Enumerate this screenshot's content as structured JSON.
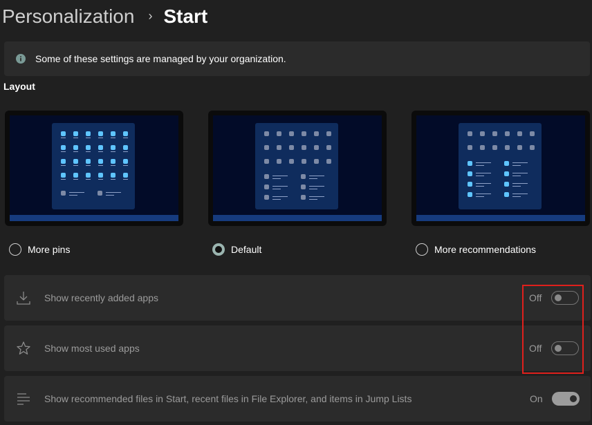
{
  "breadcrumb": {
    "parent": "Personalization",
    "separator": "›",
    "current": "Start"
  },
  "banner": {
    "icon": "info-icon",
    "text": "Some of these settings are managed by your organization."
  },
  "layout": {
    "title": "Layout",
    "options": [
      {
        "label": "More pins",
        "selected": false
      },
      {
        "label": "Default",
        "selected": true
      },
      {
        "label": "More recommendations",
        "selected": false
      }
    ]
  },
  "settings": [
    {
      "icon": "download-icon",
      "label": "Show recently added apps",
      "state": "Off",
      "on": false
    },
    {
      "icon": "star-icon",
      "label": "Show most used apps",
      "state": "Off",
      "on": false
    },
    {
      "icon": "list-icon",
      "label": "Show recommended files in Start, recent files in File Explorer, and items in Jump Lists",
      "state": "On",
      "on": true
    }
  ],
  "colors": {
    "background": "#202020",
    "card": "#2b2b2b",
    "accent_tile": "#5fc5ff",
    "highlight": "#e0201c",
    "radio_selected": "#9bb5b0"
  }
}
